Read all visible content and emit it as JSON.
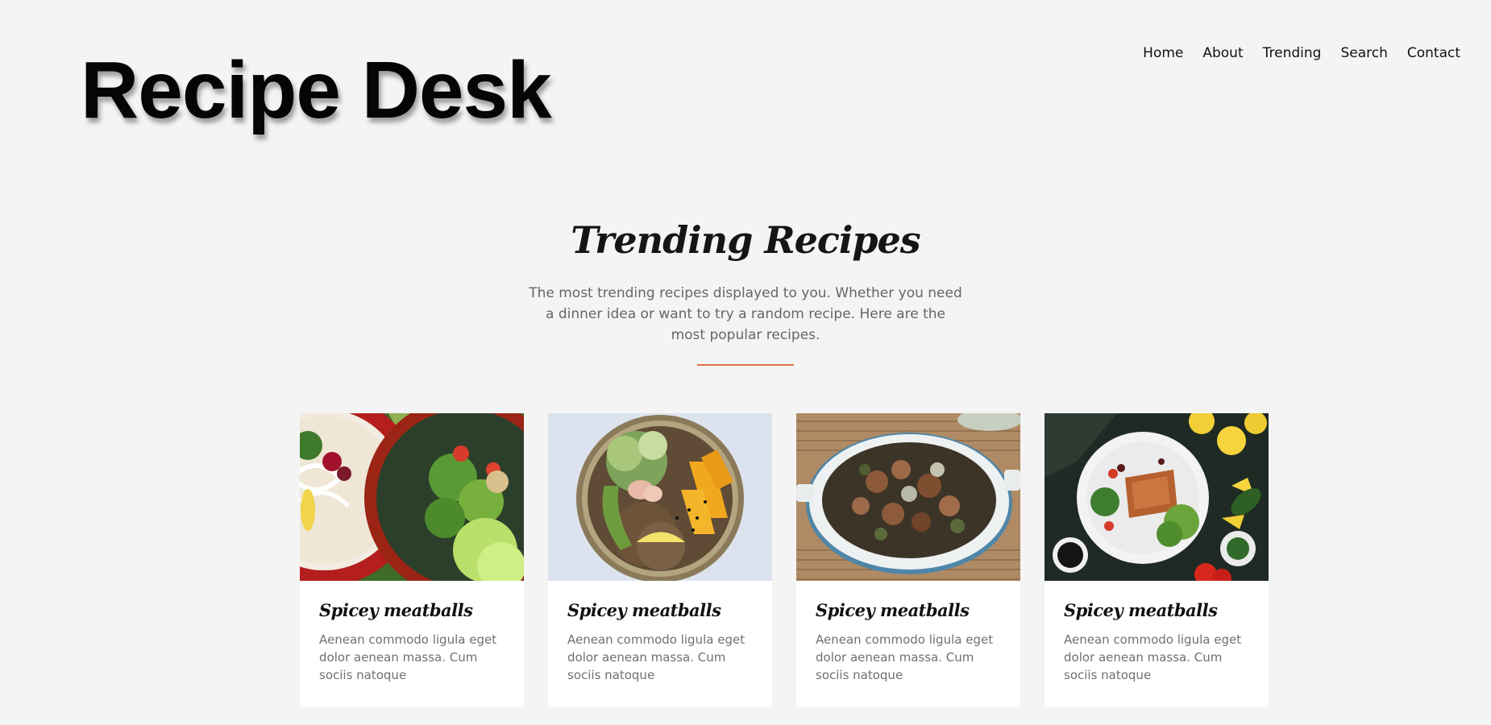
{
  "header": {
    "logo": "Recipe Desk",
    "nav": [
      "Home",
      "About",
      "Trending",
      "Search",
      "Contact"
    ]
  },
  "trending": {
    "title": "Trending Recipes",
    "description": "The most trending recipes displayed to you. Whether you need a dinner idea or want to try a random recipe. Here are the most popular recipes.",
    "accent_color": "#d9773f"
  },
  "cards": [
    {
      "title": "Spicey meatballs",
      "text": "Aenean commodo ligula eget dolor aenean massa. Cum sociis natoque",
      "image": "noodle-and-salad-bowls-photo"
    },
    {
      "title": "Spicey meatballs",
      "text": "Aenean commodo ligula eget dolor aenean massa. Cum sociis natoque",
      "image": "grain-bowl-with-mango-photo"
    },
    {
      "title": "Spicey meatballs",
      "text": "Aenean commodo ligula eget dolor aenean massa. Cum sociis natoque",
      "image": "stir-fry-dish-on-mat-photo"
    },
    {
      "title": "Spicey meatballs",
      "text": "Aenean commodo ligula eget dolor aenean massa. Cum sociis natoque",
      "image": "fish-plate-with-lemons-photo"
    }
  ]
}
